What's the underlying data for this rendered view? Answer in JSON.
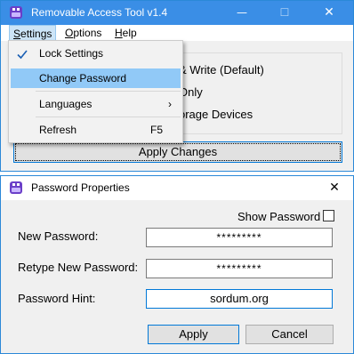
{
  "main_window": {
    "title": "Removable Access Tool v1.4",
    "controls": {
      "minimize": "—",
      "maximize": "☐",
      "close": "✕"
    },
    "menu": {
      "settings_first": "S",
      "settings_rest": "ettings",
      "options_first": "O",
      "options_rest": "ptions",
      "help_first": "H",
      "help_rest": "elp"
    },
    "radio_options": [
      "& Write (Default)",
      "Only",
      "orage Devices"
    ],
    "apply_changes_label": "Apply Changes"
  },
  "settings_menu": {
    "lock_settings": "Lock Settings",
    "lock_settings_checked": true,
    "change_password": "Change Password",
    "languages": "Languages",
    "submenu_arrow": "›",
    "refresh": "Refresh",
    "refresh_shortcut": "F5"
  },
  "dialog": {
    "title": "Password Properties",
    "close": "✕",
    "show_password_label": "Show Password",
    "show_password_checked": false,
    "new_password_label": "New Password:",
    "new_password_value": "*********",
    "retype_password_label": "Retype New Password:",
    "retype_password_value": "*********",
    "hint_label": "Password Hint:",
    "hint_value": "sordum.org",
    "apply_label": "Apply",
    "cancel_label": "Cancel"
  },
  "colors": {
    "title_bar": "#3a8ee6",
    "menu_highlight": "#91c9f7",
    "accent_border": "#0078d7",
    "icon_purple": "#6b3fc8"
  },
  "icons": {
    "app_icon": "usb-lock-icon",
    "check": "checkmark-icon",
    "submenu": "chevron-right-icon"
  }
}
